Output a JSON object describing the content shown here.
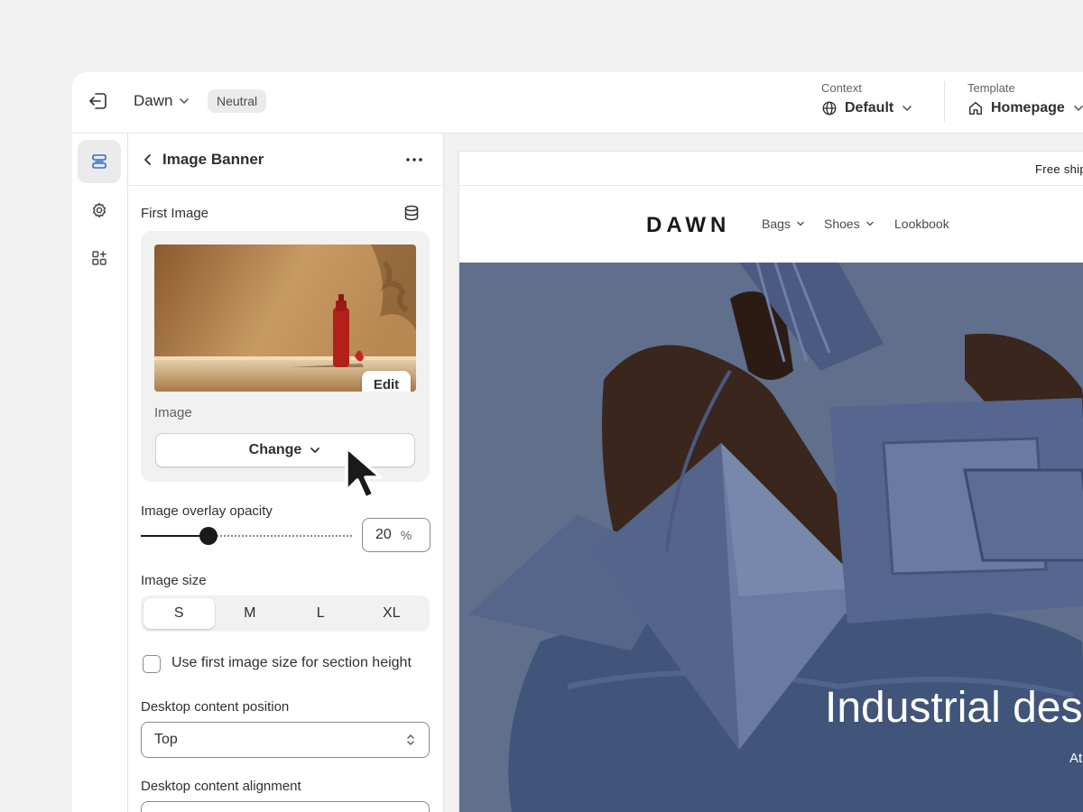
{
  "topbar": {
    "theme_name": "Dawn",
    "theme_badge": "Neutral",
    "context_label": "Context",
    "context_value": "Default",
    "template_label": "Template",
    "template_value": "Homepage"
  },
  "rail": {
    "items": [
      {
        "icon": "sections-icon",
        "active": true
      },
      {
        "icon": "gear-icon",
        "active": false
      },
      {
        "icon": "apps-icon",
        "active": false
      }
    ]
  },
  "panel": {
    "title": "Image Banner",
    "first_image_label": "First Image",
    "edit_label": "Edit",
    "image_sub_label": "Image",
    "change_label": "Change",
    "overlay_label": "Image overlay opacity",
    "overlay_value": "20",
    "overlay_unit": "%",
    "overlay_fraction": 0.2,
    "image_size_label": "Image size",
    "image_sizes": [
      "S",
      "M",
      "L",
      "XL"
    ],
    "image_size_selected": "S",
    "checkbox_label": "Use first image size for section height",
    "checkbox_checked": false,
    "desktop_position_label": "Desktop content position",
    "desktop_position_value": "Top",
    "desktop_alignment_label": "Desktop content alignment"
  },
  "preview": {
    "announcement": "Free ship",
    "logo": "DAWN",
    "nav": [
      "Bags",
      "Shoes",
      "Lookbook"
    ],
    "hero_title": "Industrial des",
    "hero_subtitle": "At"
  },
  "colors": {
    "accent": "#303030",
    "hero_bg": "#5f6f8c",
    "panel_bg": "#ffffff",
    "canvas_bg": "#f1f1f1"
  }
}
